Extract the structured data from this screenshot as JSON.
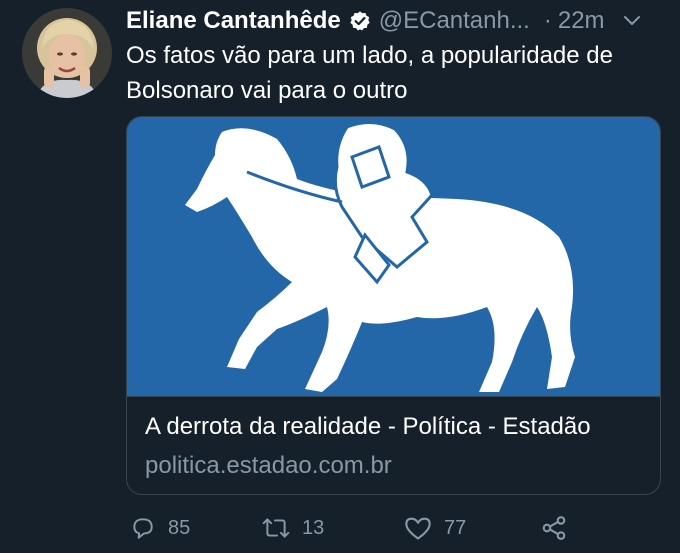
{
  "tweet": {
    "author_name": "Eliane Cantanhêde",
    "handle": "@ECantanh...",
    "separator": "·",
    "time": "22m",
    "text": "Os fatos vão para um lado, a popularidade de Bolsonaro vai para o outro"
  },
  "card": {
    "title": "A derrota da realidade - Política - Estadão",
    "domain": "politica.estadao.com.br"
  },
  "actions": {
    "replies": "85",
    "retweets": "13",
    "likes": "77"
  },
  "colors": {
    "background": "#15202b",
    "secondary_text": "#8899a6",
    "verified_blue": "#ffffff",
    "card_image_blue": "#2467a8",
    "border": "#38444d"
  }
}
